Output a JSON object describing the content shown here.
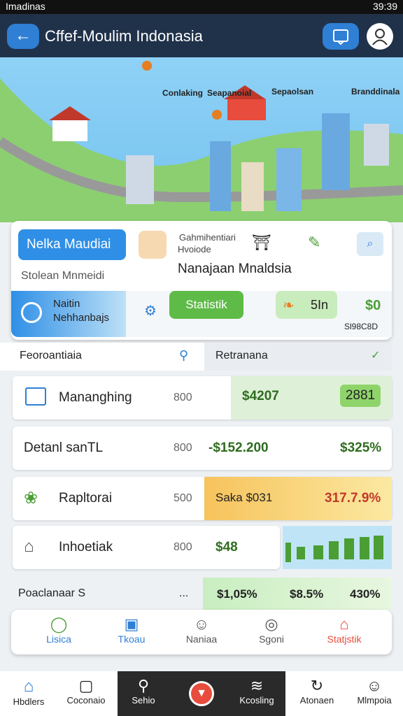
{
  "status": {
    "left": "Imadinas",
    "right": "39:39"
  },
  "appbar": {
    "title": "Cffef-Moulim Indonasia"
  },
  "map": {
    "labels": [
      "Conlaking",
      "Seapanoial",
      "Sepaolsan",
      "Branddinala"
    ]
  },
  "card": {
    "tag": "Nelka Maudiai",
    "sub": "Stolean Mnmeidi",
    "caption1": "Gahmihentiari",
    "caption2": "Hvoiode",
    "headline": "Nanajaan Mnaldsia",
    "status_label1": "Naitin",
    "status_label2": "Nehhanbajs",
    "stats_btn": "Statistik",
    "sin": "5In",
    "amount": "$0",
    "small": "Sl98C8D"
  },
  "sections": {
    "left": "Feoroantiaia",
    "right": "Retranana"
  },
  "rows": [
    {
      "label": "Mananghing",
      "num": "800",
      "v1": "$4207",
      "v2": "2881"
    },
    {
      "label": "Detanl sanTL",
      "num": "800",
      "v1": "-$152.200",
      "v2": "$325%"
    },
    {
      "label": "Rapltorai",
      "num": "500",
      "v1": "Saka $031",
      "v2": "317.7.9%"
    },
    {
      "label": "Inhoetiak",
      "num": "800",
      "v1": "$48"
    }
  ],
  "footer_row": {
    "label": "Poaclanaar S",
    "dots": "...",
    "v1": "$1,05%",
    "v2": "$8.5%",
    "v3": "430%"
  },
  "navcard": [
    "Lisica",
    "Tkoau",
    "Naniaa",
    "Sgoni",
    "Statjstik"
  ],
  "bottomnav": [
    "Hbdlers",
    "Coconaio",
    "Sehio",
    "",
    "Kcosling",
    "Atonaen",
    "Mlmpoia"
  ],
  "colors": {
    "accent": "#2f7fd4",
    "green": "#5fbb47",
    "orange": "#f5a623"
  }
}
